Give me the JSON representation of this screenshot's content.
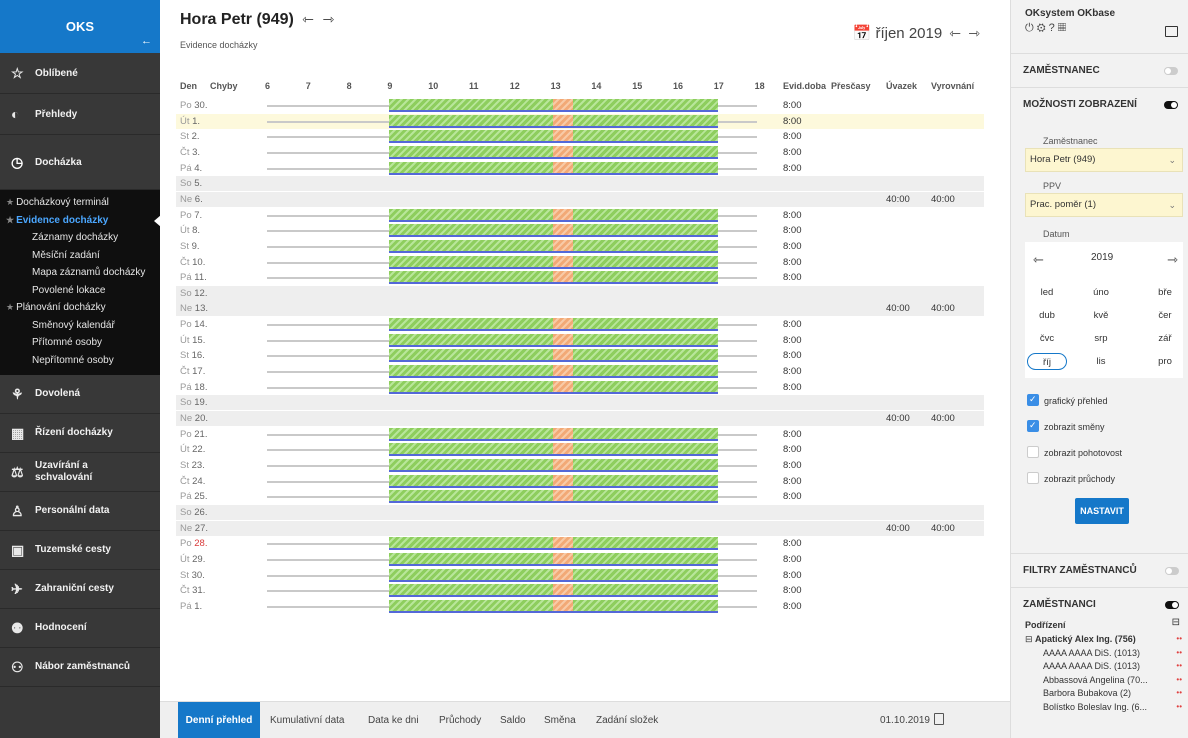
{
  "sidebar": {
    "logo": "OKS",
    "collapse_icon": "arrow-left",
    "items": [
      {
        "label": "Oblíbené",
        "icon": "star-icon"
      },
      {
        "label": "Přehledy",
        "icon": "chart-icon"
      },
      {
        "label": "Docházka",
        "icon": "clock-icon"
      }
    ],
    "sub_items": [
      {
        "label": "Docházkový terminál",
        "star": true
      },
      {
        "label": "Evidence docházky",
        "star": true,
        "selected": true
      },
      {
        "label": "Záznamy docházky"
      },
      {
        "label": "Měsíční zadání"
      },
      {
        "label": "Mapa záznamů docházky"
      },
      {
        "label": "Povolené lokace"
      },
      {
        "label": "Plánování docházky",
        "star": true
      },
      {
        "label": "Směnový kalendář"
      },
      {
        "label": "Přítomné osoby"
      },
      {
        "label": "Nepřítomné osoby"
      }
    ],
    "items_bottom": [
      {
        "label": "Dovolená",
        "icon": "vacation-icon"
      },
      {
        "label": "Řízení docházky",
        "icon": "calendar-icon"
      },
      {
        "label": "Uzavírání a schvalování",
        "icon": "gavel-icon"
      },
      {
        "label": "Personální data",
        "icon": "person-icon"
      },
      {
        "label": "Tuzemské cesty",
        "icon": "bus-icon"
      },
      {
        "label": "Zahraniční cesty",
        "icon": "plane-icon"
      },
      {
        "label": "Hodnocení",
        "icon": "rating-icon"
      },
      {
        "label": "Nábor zaměstnanců",
        "icon": "recruit-icon"
      }
    ]
  },
  "header": {
    "title": "Hora Petr (949)",
    "subtitle": "Evidence docházky",
    "month": "říjen 2019"
  },
  "grid": {
    "col_headers": {
      "den": "Den",
      "chyby": "Chyby",
      "evid": "Evid.doba",
      "prescasy": "Přesčasy",
      "uvazek": "Úvazek",
      "vyrovnani": "Vyrovnání"
    },
    "hours": [
      "6",
      "7",
      "8",
      "9",
      "10",
      "11",
      "12",
      "13",
      "14",
      "15",
      "16",
      "17",
      "18"
    ],
    "rows": [
      {
        "dn": "Po",
        "d": "30.",
        "ev": "8:00"
      },
      {
        "dn": "Út",
        "d": "1.",
        "ev": "8:00",
        "hl": true
      },
      {
        "dn": "St",
        "d": "2.",
        "ev": "8:00"
      },
      {
        "dn": "Čt",
        "d": "3.",
        "ev": "8:00"
      },
      {
        "dn": "Pá",
        "d": "4.",
        "ev": "8:00"
      },
      {
        "dn": "So",
        "d": "5.",
        "we": true
      },
      {
        "dn": "Ne",
        "d": "6.",
        "we": true,
        "uv": "40:00",
        "vy": "40:00"
      },
      {
        "dn": "Po",
        "d": "7.",
        "ev": "8:00"
      },
      {
        "dn": "Út",
        "d": "8.",
        "ev": "8:00"
      },
      {
        "dn": "St",
        "d": "9.",
        "ev": "8:00"
      },
      {
        "dn": "Čt",
        "d": "10.",
        "ev": "8:00"
      },
      {
        "dn": "Pá",
        "d": "11.",
        "ev": "8:00"
      },
      {
        "dn": "So",
        "d": "12.",
        "we": true
      },
      {
        "dn": "Ne",
        "d": "13.",
        "we": true,
        "uv": "40:00",
        "vy": "40:00"
      },
      {
        "dn": "Po",
        "d": "14.",
        "ev": "8:00"
      },
      {
        "dn": "Út",
        "d": "15.",
        "ev": "8:00"
      },
      {
        "dn": "St",
        "d": "16.",
        "ev": "8:00"
      },
      {
        "dn": "Čt",
        "d": "17.",
        "ev": "8:00"
      },
      {
        "dn": "Pá",
        "d": "18.",
        "ev": "8:00"
      },
      {
        "dn": "So",
        "d": "19.",
        "we": true
      },
      {
        "dn": "Ne",
        "d": "20.",
        "we": true,
        "uv": "40:00",
        "vy": "40:00"
      },
      {
        "dn": "Po",
        "d": "21.",
        "ev": "8:00"
      },
      {
        "dn": "Út",
        "d": "22.",
        "ev": "8:00"
      },
      {
        "dn": "St",
        "d": "23.",
        "ev": "8:00"
      },
      {
        "dn": "Čt",
        "d": "24.",
        "ev": "8:00"
      },
      {
        "dn": "Pá",
        "d": "25.",
        "ev": "8:00"
      },
      {
        "dn": "So",
        "d": "26.",
        "we": true
      },
      {
        "dn": "Ne",
        "d": "27.",
        "we": true,
        "uv": "40:00",
        "vy": "40:00"
      },
      {
        "dn": "Po",
        "d": "28.",
        "ev": "8:00",
        "red": true
      },
      {
        "dn": "Út",
        "d": "29.",
        "ev": "8:00"
      },
      {
        "dn": "St",
        "d": "30.",
        "ev": "8:00"
      },
      {
        "dn": "Čt",
        "d": "31.",
        "ev": "8:00"
      },
      {
        "dn": "Pá",
        "d": "1.",
        "ev": "8:00"
      }
    ]
  },
  "tabs": [
    "Denní přehled",
    "Kumulativní data",
    "Data ke dni",
    "Průchody",
    "Saldo",
    "Směna",
    "Zadání složek"
  ],
  "tab_date": "01.10.2019",
  "panel": {
    "title": "OKsystem OKbase",
    "sec_zamestnanec": "ZAMĚSTNANEC",
    "sec_moznosti": "MOŽNOSTI ZOBRAZENÍ",
    "lbl_zam": "Zaměstnanec",
    "val_zam": "Hora Petr (949)",
    "lbl_ppv": "PPV",
    "val_ppv": "Prac. poměr (1)",
    "lbl_datum": "Datum",
    "year": "2019",
    "months": [
      "led",
      "úno",
      "bře",
      "dub",
      "kvě",
      "čer",
      "čvc",
      "srp",
      "zář",
      "říj",
      "lis",
      "pro"
    ],
    "cb1": "grafický přehled",
    "cb2": "zobrazit směny",
    "cb3": "zobrazit pohotovost",
    "cb4": "zobrazit průchody",
    "btn": "NASTAVIT",
    "sec_filtry": "FILTRY ZAMĚSTNANCŮ",
    "sec_zamestnanci": "ZAMĚSTNANCI",
    "podrizeni": "Podřízení",
    "employees": [
      "Apatický Alex Ing. (756)",
      "AAAA AAAA DiS. (1013)",
      "AAAA AAAA DiS. (1013)",
      "Abbassová Angelina (70...",
      "Barbora Bubakova (2)",
      "Bolístko Boleslav Ing. (6..."
    ]
  }
}
